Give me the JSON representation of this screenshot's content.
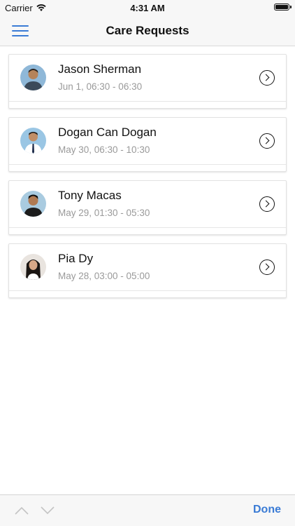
{
  "status_bar": {
    "carrier": "Carrier",
    "time": "4:31 AM",
    "wifi_icon": "wifi-icon",
    "battery_icon": "battery-icon"
  },
  "nav": {
    "title": "Care Requests",
    "menu_icon": "hamburger-menu-icon",
    "accent_color": "#3a7bd5"
  },
  "requests": [
    {
      "name": "Jason Sherman",
      "time": "Jun 1, 06:30 - 06:30",
      "avatar_icon": "avatar-icon"
    },
    {
      "name": "Dogan Can Dogan",
      "time": "May 30, 06:30 - 10:30",
      "avatar_icon": "avatar-icon"
    },
    {
      "name": "Tony Macas",
      "time": "May 29, 01:30 - 05:30",
      "avatar_icon": "avatar-icon"
    },
    {
      "name": "Pia Dy",
      "time": "May 28, 03:00 - 05:00",
      "avatar_icon": "avatar-icon"
    }
  ],
  "toolbar": {
    "prev_icon": "chevron-up-icon",
    "next_icon": "chevron-down-icon",
    "done_label": "Done"
  }
}
